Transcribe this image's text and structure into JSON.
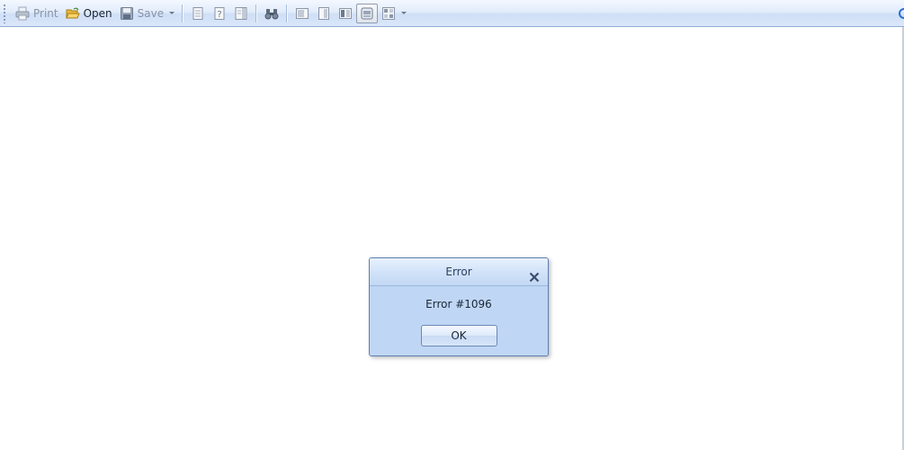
{
  "toolbar": {
    "print_label": "Print",
    "open_label": "Open",
    "save_label": "Save",
    "icons": [
      "print-icon",
      "open-folder-icon",
      "save-icon",
      "single-page-icon",
      "help-page-icon",
      "page-columns-icon",
      "find-binoculars-icon",
      "view-left-icon",
      "view-page-icon",
      "view-facing-icon",
      "view-printer-icon",
      "layout-grid-icon"
    ]
  },
  "dialog": {
    "title": "Error",
    "message": "Error #1096",
    "ok_label": "OK"
  },
  "colors": {
    "toolbar_bg": "#dbe7fa",
    "dialog_bg": "#c7dcf6",
    "dialog_border": "#5f7fae",
    "accent": "#2b6fd1"
  }
}
